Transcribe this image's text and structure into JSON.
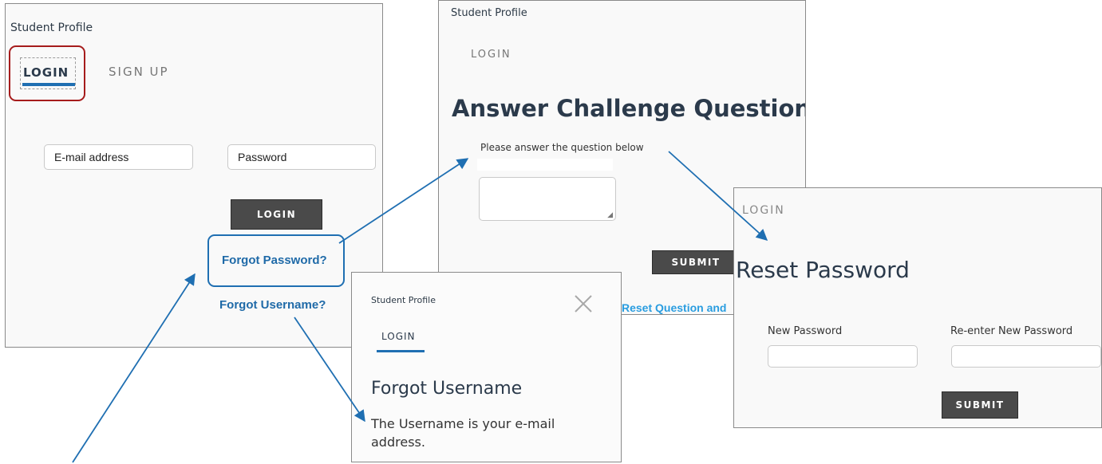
{
  "login_panel": {
    "title": "Student Profile",
    "tab_login": "LOGIN",
    "tab_signup": "SIGN UP",
    "email_placeholder": "E-mail address",
    "password_placeholder": "Password",
    "login_button": "LOGIN",
    "forgot_password": "Forgot Password?",
    "forgot_username": "Forgot Username?"
  },
  "challenge_panel": {
    "title": "Student Profile",
    "tab_login": "LOGIN",
    "heading": "Answer Challenge Question",
    "instruction": "Please answer the question below",
    "submit_button": "SUBMIT",
    "reset_link": "Reset Question and"
  },
  "username_panel": {
    "title": "Student Profile",
    "tab_login": "LOGIN",
    "heading": "Forgot Username",
    "message": "The Username is your e-mail address."
  },
  "reset_panel": {
    "tab_login": "LOGIN",
    "heading": "Reset Password",
    "new_password_label": "New Password",
    "reenter_label": "Re-enter New Password",
    "submit_button": "SUBMIT"
  },
  "colors": {
    "highlight_red": "#a61c1c",
    "annotation_blue": "#1f6fb2",
    "tab_underline": "#1f6fb2"
  }
}
